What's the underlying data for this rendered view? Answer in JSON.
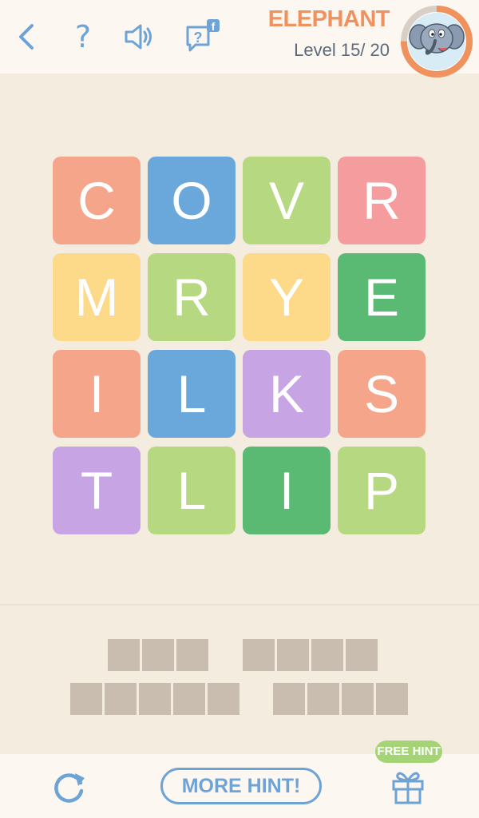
{
  "header": {
    "title": "ELEPHANT",
    "level_text": "Level 15/ 20",
    "help_glyph": "?",
    "icons": [
      "back-chevron-icon",
      "question-icon",
      "speaker-icon",
      "facebook-question-icon"
    ],
    "level_progress": 0.75
  },
  "grid": {
    "tiles": [
      {
        "letter": "C",
        "color": "#f5a58a"
      },
      {
        "letter": "O",
        "color": "#6aa8dc"
      },
      {
        "letter": "V",
        "color": "#b6d880"
      },
      {
        "letter": "R",
        "color": "#f59c9f"
      },
      {
        "letter": "M",
        "color": "#fdd98a"
      },
      {
        "letter": "R",
        "color": "#b6d880"
      },
      {
        "letter": "Y",
        "color": "#fdd98a"
      },
      {
        "letter": "E",
        "color": "#5aba73"
      },
      {
        "letter": "I",
        "color": "#f5a58a"
      },
      {
        "letter": "L",
        "color": "#6aa8dc"
      },
      {
        "letter": "K",
        "color": "#c7a4e3"
      },
      {
        "letter": "S",
        "color": "#f5a58a"
      },
      {
        "letter": "T",
        "color": "#c7a4e3"
      },
      {
        "letter": "L",
        "color": "#b6d880"
      },
      {
        "letter": "I",
        "color": "#5aba73"
      },
      {
        "letter": "P",
        "color": "#b6d880"
      }
    ]
  },
  "answers": {
    "word_lengths": [
      3,
      4,
      5,
      4
    ]
  },
  "footer": {
    "more_hint_label": "MORE HINT!",
    "free_hint_label": "FREE HINT",
    "icons": [
      "refresh-icon",
      "gift-icon"
    ]
  },
  "colors": {
    "accent_blue": "#6ea3d6",
    "accent_orange": "#f0925d",
    "free_hint_green": "#a5d476",
    "empty_box": "#c9bdaf"
  }
}
